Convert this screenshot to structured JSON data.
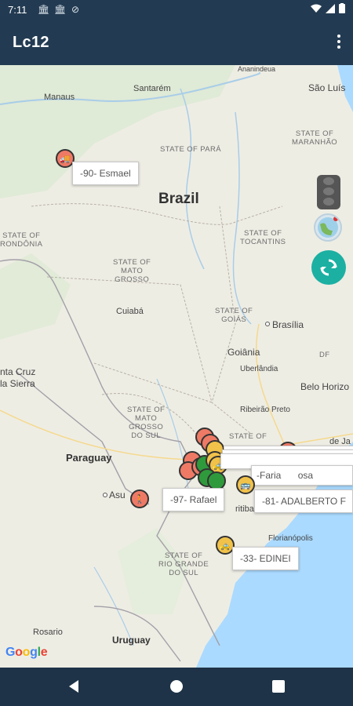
{
  "status_bar": {
    "time": "7:11"
  },
  "app_bar": {
    "title": "Lc12"
  },
  "map": {
    "country_labels": {
      "brazil": "Brazil",
      "paraguay": "Paraguay",
      "uruguay": "Uruguay"
    },
    "state_labels": {
      "para": "STATE OF PARÁ",
      "maranhao_l1": "STATE OF",
      "maranhao_l2": "MARANHÃO",
      "tocantins_l1": "STATE OF",
      "tocantins_l2": "TOCANTINS",
      "mato_grosso_l1": "STATE OF",
      "mato_grosso_l2": "MATO",
      "mato_grosso_l3": "GROSSO",
      "goias_l1": "STATE OF",
      "goias_l2": "GOIÁS",
      "ms_l1": "STATE OF",
      "ms_l2": "MATO",
      "ms_l3": "GROSSO",
      "ms_l4": "DO SUL",
      "rondonia_l1": "STATE OF",
      "rondonia_l2": "RONDÔNIA",
      "rs_l1": "STATE OF",
      "rs_l2": "RIO GRANDE",
      "rs_l3": "DO SUL",
      "sp_partial": "STATE OF",
      "df": "DF"
    },
    "city_labels": {
      "manaus": "Manaus",
      "santarem": "Santarém",
      "anapolis_n": "Ananindeua",
      "sao_luis": "São Luís",
      "cuiaba": "Cuiabá",
      "brasilia": "Brasília",
      "goiania": "Goiânia",
      "uberlandia": "Uberlândia",
      "belo_horizonte": "Belo Horizo",
      "ribeirao_preto": "Ribeirão Preto",
      "santa_cruz_l1": "nta Cruz",
      "santa_cruz_l2": "la Sierra",
      "asuncion": "Asu",
      "curitiba": "ritiba",
      "florianopolis": "Florianópolis",
      "rosario": "Rosario",
      "rio": "de Ja",
      "hidden_sp": "osa"
    },
    "info_windows": [
      {
        "label": "-90- Esmael"
      },
      {
        "label": "-97- Rafael"
      },
      {
        "label": "-81- ADALBERTO F"
      },
      {
        "label": "-33- EDINEI"
      },
      {
        "label": "-Faria"
      }
    ],
    "markers": [
      "truck-red",
      "person-red",
      "bus-yellow",
      "car-yellow",
      "car-green",
      "truck-red-cluster"
    ],
    "attribution": "Google"
  },
  "controls": {
    "traffic": "traffic-light-icon",
    "globe": "globe-icon",
    "refresh": "refresh-icon"
  },
  "colors": {
    "app_bar": "#233b52",
    "marker_red": "#ee7a66",
    "marker_yellow": "#f1c24a",
    "marker_green": "#2f9a3c",
    "refresh": "#1bb0a2",
    "water": "#aadaff"
  }
}
